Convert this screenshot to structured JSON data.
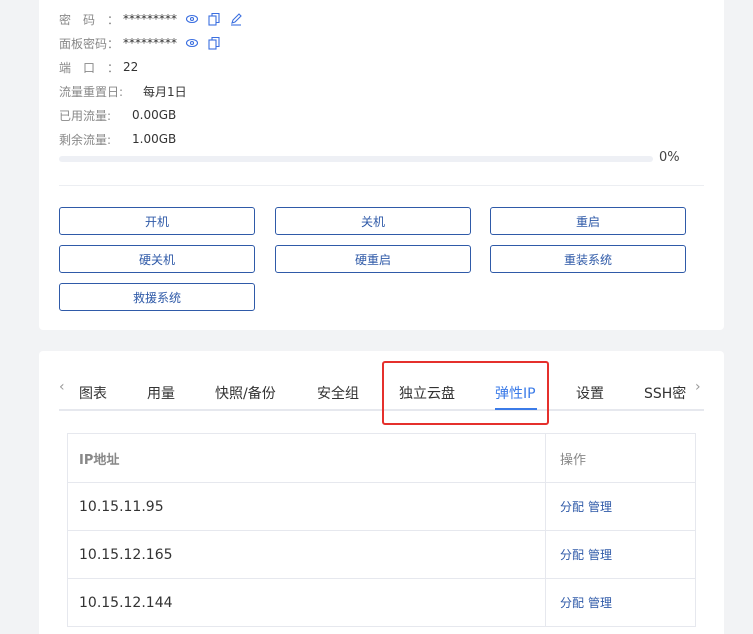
{
  "info": {
    "password_label": "密　码　：",
    "password_value": "*********",
    "panel_password_label": "面板密码：",
    "panel_password_value": "*********",
    "port_label": "端　口　：",
    "port_value": "22",
    "reset_label": "流量重置日:",
    "reset_value": "每月1日",
    "used_label": "已用流量:",
    "used_value": "0.00GB",
    "remaining_label": "剩余流量:",
    "remaining_value": "1.00GB",
    "progress_percent": 0,
    "progress_text": "0%"
  },
  "actions": {
    "power_on": "开机",
    "shutdown": "关机",
    "reboot": "重启",
    "hard_shutdown": "硬关机",
    "hard_reboot": "硬重启",
    "reinstall": "重装系统",
    "rescue": "救援系统"
  },
  "tabs": [
    {
      "label": "图表"
    },
    {
      "label": "用量"
    },
    {
      "label": "快照/备份"
    },
    {
      "label": "安全组"
    },
    {
      "label": "独立云盘"
    },
    {
      "label": "弹性IP"
    },
    {
      "label": "设置"
    },
    {
      "label": "SSH密"
    }
  ],
  "active_tab": "弹性IP",
  "table": {
    "headers": [
      "IP地址",
      "操作"
    ],
    "rows": [
      {
        "ip": "10.15.11.95",
        "assign": "分配",
        "manage": "管理"
      },
      {
        "ip": "10.15.12.165",
        "assign": "分配",
        "manage": "管理"
      },
      {
        "ip": "10.15.12.144",
        "assign": "分配",
        "manage": "管理"
      }
    ]
  },
  "colors": {
    "accent": "#3b7be8",
    "button_border": "#2f5aa8",
    "highlight": "#e5302c"
  },
  "icons": [
    "eye-icon",
    "copy-icon",
    "edit-icon"
  ]
}
